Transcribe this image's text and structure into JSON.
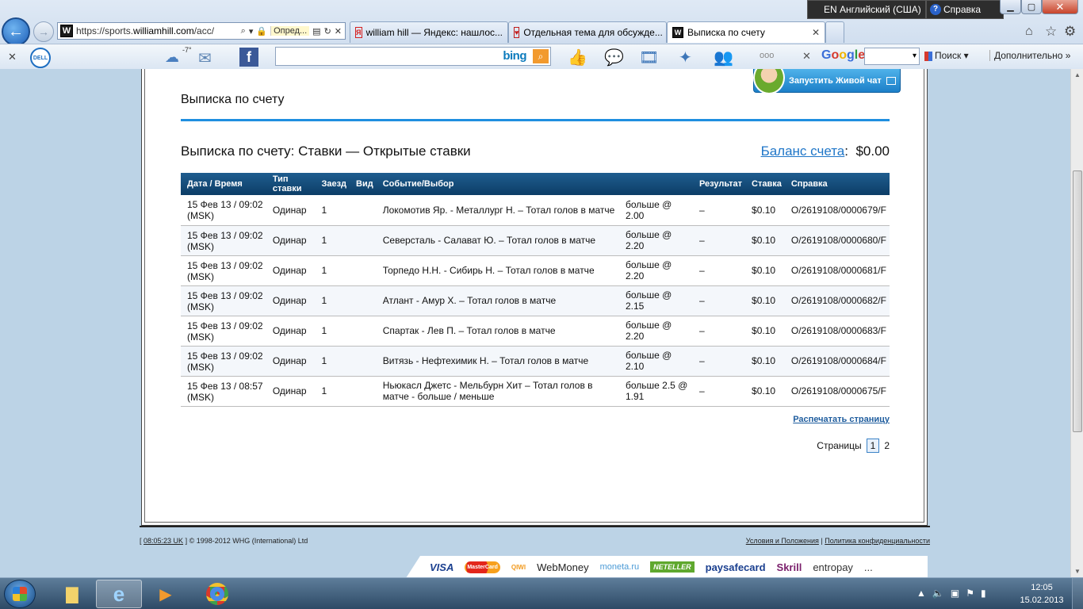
{
  "browser": {
    "address_url_prefix": "https://sports.",
    "address_url_domain": "williamhill.com",
    "address_url_suffix": "/acc/",
    "address_cert_label": "Опред...",
    "lang_indicator": "EN Английский (США)",
    "help_label": "Справка",
    "tabs": [
      {
        "label": "william hill — Яндекс: нашлос...",
        "icon": "yandex-icon"
      },
      {
        "label": "Отдельная тема для обсужде...",
        "icon": "forum-icon"
      },
      {
        "label": "Выписка по счету",
        "icon": "williamhill-icon",
        "active": true
      }
    ],
    "weather_temp": "-7°",
    "bing_label": "bing",
    "google_label": "Google",
    "google_search_label": "Поиск",
    "more_label": "Дополнительно »",
    "dots_label": "ooo"
  },
  "page": {
    "title": "Выписка по счету",
    "chat_button": "Запустить Живой чат",
    "subheading": "Выписка по счету: Ставки — Открытые ставки",
    "balance_label": "Баланс счета",
    "balance_colon": ":",
    "balance_value": "$0.00",
    "print_link": "Распечатать страницу",
    "pages_label": "Страницы",
    "pages": [
      "1",
      "2"
    ],
    "current_page": "1"
  },
  "table": {
    "headers": {
      "datetime": "Дата / Время",
      "bet_type": "Тип ставки",
      "race": "Заезд",
      "kind": "Вид",
      "event": "Событие/Выбор",
      "result": "Результат",
      "stake": "Ставка",
      "ref": "Справка"
    },
    "rows": [
      {
        "datetime": "15 Фев 13 / 09:02 (MSK)",
        "bet_type": "Одинар",
        "race": "1",
        "kind": "",
        "event": "Локомотив Яр. - Металлург Н. – Тотал голов в матче",
        "selection": "больше @ 2.00",
        "result": "–",
        "stake": "$0.10",
        "ref": "O/2619108/0000679/F"
      },
      {
        "datetime": "15 Фев 13 / 09:02 (MSK)",
        "bet_type": "Одинар",
        "race": "1",
        "kind": "",
        "event": "Северсталь - Салават Ю. – Тотал голов в матче",
        "selection": "больше @ 2.20",
        "result": "–",
        "stake": "$0.10",
        "ref": "O/2619108/0000680/F"
      },
      {
        "datetime": "15 Фев 13 / 09:02 (MSK)",
        "bet_type": "Одинар",
        "race": "1",
        "kind": "",
        "event": "Торпедо Н.Н. - Сибирь Н. – Тотал голов в матче",
        "selection": "больше @ 2.20",
        "result": "–",
        "stake": "$0.10",
        "ref": "O/2619108/0000681/F"
      },
      {
        "datetime": "15 Фев 13 / 09:02 (MSK)",
        "bet_type": "Одинар",
        "race": "1",
        "kind": "",
        "event": "Атлант - Амур Х. – Тотал голов в матче",
        "selection": "больше @ 2.15",
        "result": "–",
        "stake": "$0.10",
        "ref": "O/2619108/0000682/F"
      },
      {
        "datetime": "15 Фев 13 / 09:02 (MSK)",
        "bet_type": "Одинар",
        "race": "1",
        "kind": "",
        "event": "Спартак - Лев П. – Тотал голов в матче",
        "selection": "больше @ 2.20",
        "result": "–",
        "stake": "$0.10",
        "ref": "O/2619108/0000683/F"
      },
      {
        "datetime": "15 Фев 13 / 09:02 (MSK)",
        "bet_type": "Одинар",
        "race": "1",
        "kind": "",
        "event": "Витязь - Нефтехимик Н. – Тотал голов в матче",
        "selection": "больше @ 2.10",
        "result": "–",
        "stake": "$0.10",
        "ref": "O/2619108/0000684/F"
      },
      {
        "datetime": "15 Фев 13 / 08:57 (MSK)",
        "bet_type": "Одинар",
        "race": "1",
        "kind": "",
        "event": "Ньюкасл Джетс - Мельбурн Хит – Тотал голов в матче - больше / меньше",
        "selection": "больше 2.5 @ 1.91",
        "result": "–",
        "stake": "$0.10",
        "ref": "O/2619108/0000675/F"
      }
    ]
  },
  "footer": {
    "time_link": "08:05:23 UK",
    "copyright": "© 1998-2012 WHG (International) Ltd",
    "terms_link": "Условия и Положения",
    "privacy_link": "Политика конфиденциальности",
    "payments": [
      "VISA",
      "MasterCard",
      "QIWI",
      "WebMoney",
      "moneta.ru",
      "NETELLER",
      "paysafecard",
      "Skrill",
      "entropay",
      "..."
    ]
  },
  "taskbar": {
    "time": "12:05",
    "date": "15.02.2013"
  },
  "colors": {
    "accent_blue": "#1f8fe0",
    "table_header": "#0c3d66",
    "link": "#1f76c8"
  }
}
